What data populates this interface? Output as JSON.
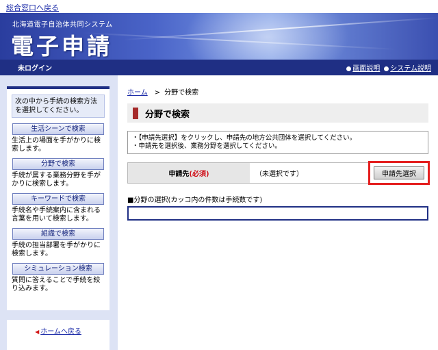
{
  "top": {
    "back_link": "総合窓口へ戻る"
  },
  "banner": {
    "subtitle": "北海道電子自治体共同システム",
    "title": "電子申請"
  },
  "navbar": {
    "login_status": "未ログイン",
    "help_link": "画面説明",
    "system_link": "システム説明"
  },
  "sidebar": {
    "intro": "次の中から手続の検索方法を選択してください。",
    "items": [
      {
        "label": "生活シーンで検索",
        "desc": "生活上の場面を手がかりに検索します。"
      },
      {
        "label": "分野で検索",
        "desc": "手続が属する業務分野を手がかりに検索します。"
      },
      {
        "label": "キーワードで検索",
        "desc": "手続名や手続案内に含まれる言葉を用いて検索します。"
      },
      {
        "label": "組織で検索",
        "desc": "手続の担当部署を手がかりに検索します。"
      },
      {
        "label": "シミュレーション検索",
        "desc": "質問に答えることで手続を絞り込みます。"
      }
    ],
    "home_link": "ホームへ戻る"
  },
  "main": {
    "breadcrumb": {
      "home": "ホーム",
      "separator": ">",
      "current": "分野で検索"
    },
    "heading": "分野で検索",
    "notice": [
      "・【申請先選択】をクリックし、申請先の地方公共団体を選択してください。",
      "・申請先を選択後、業務分野を選択してください。"
    ],
    "applicant": {
      "label": "申請先",
      "required": "(必須)",
      "value": "（未選択です）",
      "button": "申請先選択"
    },
    "field_selection": {
      "title": "■分野の選択(カッコ内の件数は手続数です)"
    }
  },
  "colors": {
    "navbar": "#1f2f84",
    "accent_red": "#e41f1f",
    "heading_bar": "#a52a2a",
    "sidebar_bg": "#dde3f5"
  }
}
